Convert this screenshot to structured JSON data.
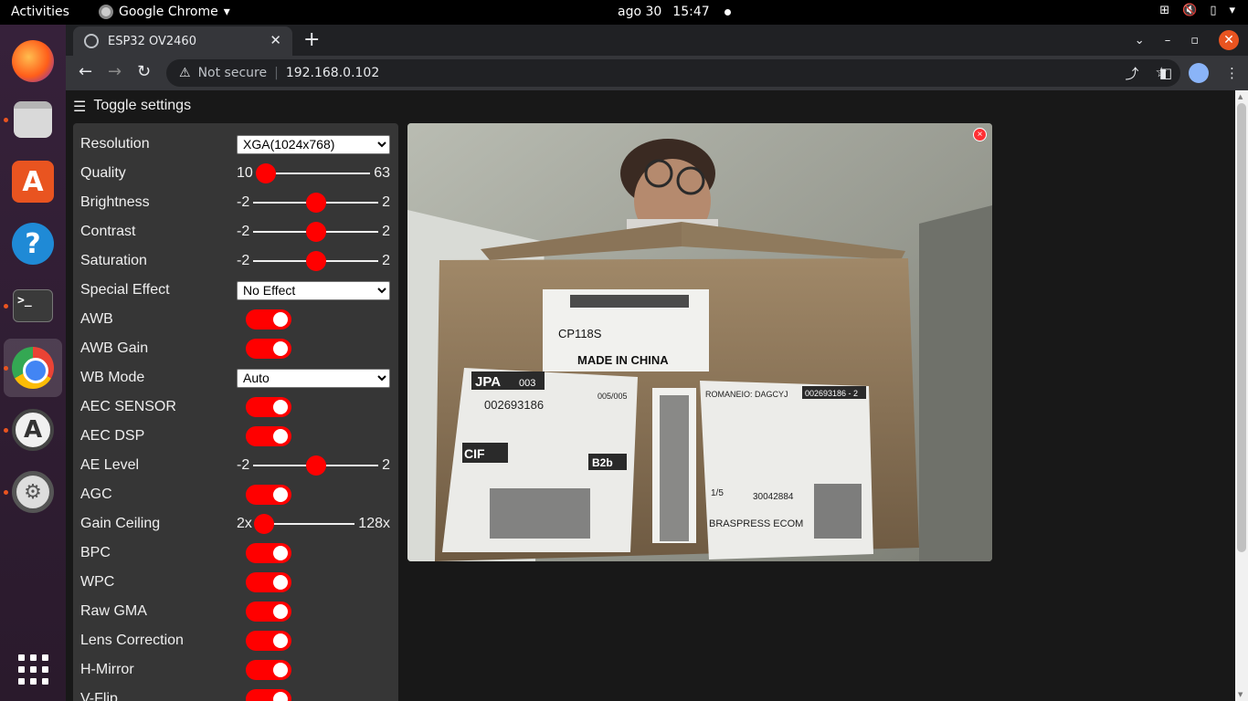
{
  "topbar": {
    "activities": "Activities",
    "app_name": "Google Chrome",
    "date": "ago 30",
    "time": "15:47"
  },
  "dock": {
    "items": [
      "firefox-icon",
      "files-icon",
      "software-icon",
      "help-icon",
      "terminal-icon",
      "chrome-icon",
      "software-updater-icon",
      "settings-icon"
    ],
    "terminal_prompt": ">_",
    "help_glyph": "?",
    "software_glyph": "A",
    "updater_glyph": "A"
  },
  "browser": {
    "tab_title": "ESP32 OV2460",
    "security_label": "Not secure",
    "url": "192.168.0.102"
  },
  "page": {
    "toggle_label": "Toggle settings",
    "controls": [
      {
        "type": "select",
        "label": "Resolution",
        "value": "XGA(1024x768)"
      },
      {
        "type": "range",
        "label": "Quality",
        "min": "10",
        "max": "63",
        "level": 0.0
      },
      {
        "type": "range",
        "label": "Brightness",
        "min": "-2",
        "max": "2",
        "level": 0.5
      },
      {
        "type": "range",
        "label": "Contrast",
        "min": "-2",
        "max": "2",
        "level": 0.5
      },
      {
        "type": "range",
        "label": "Saturation",
        "min": "-2",
        "max": "2",
        "level": 0.5
      },
      {
        "type": "select",
        "label": "Special Effect",
        "value": "No Effect"
      },
      {
        "type": "switch",
        "label": "AWB",
        "on": true
      },
      {
        "type": "switch",
        "label": "AWB Gain",
        "on": true
      },
      {
        "type": "select",
        "label": "WB Mode",
        "value": "Auto"
      },
      {
        "type": "switch",
        "label": "AEC SENSOR",
        "on": true
      },
      {
        "type": "switch",
        "label": "AEC DSP",
        "on": true
      },
      {
        "type": "range",
        "label": "AE Level",
        "min": "-2",
        "max": "2",
        "level": 0.5
      },
      {
        "type": "switch",
        "label": "AGC",
        "on": true
      },
      {
        "type": "range",
        "label": "Gain Ceiling",
        "min": "2x",
        "max": "128x",
        "level": 0.0
      },
      {
        "type": "switch",
        "label": "BPC",
        "on": true
      },
      {
        "type": "switch",
        "label": "WPC",
        "on": true
      },
      {
        "type": "switch",
        "label": "Raw GMA",
        "on": true
      },
      {
        "type": "switch",
        "label": "Lens Correction",
        "on": true
      },
      {
        "type": "switch",
        "label": "H-Mirror",
        "on": true
      },
      {
        "type": "switch",
        "label": "V-Flip",
        "on": true
      }
    ],
    "stream_close_glyph": "×",
    "box_labels": {
      "model": "CP118S",
      "origin": "MADE IN CHINA",
      "tag": "JPA",
      "tag_num": "003",
      "tracking": "002693186",
      "count": "005/005",
      "recipient": "ROMANEIO: DAGCYJ",
      "ref": "002693186 - 2",
      "carrier": "BRASPRESS ECOM",
      "code": "B2b",
      "cif": "CIF",
      "part": "1/5",
      "nf": "30042884"
    }
  },
  "colors": {
    "accent": "#ff0000",
    "sidebar_bg": "#363636",
    "page_bg": "#181818"
  }
}
